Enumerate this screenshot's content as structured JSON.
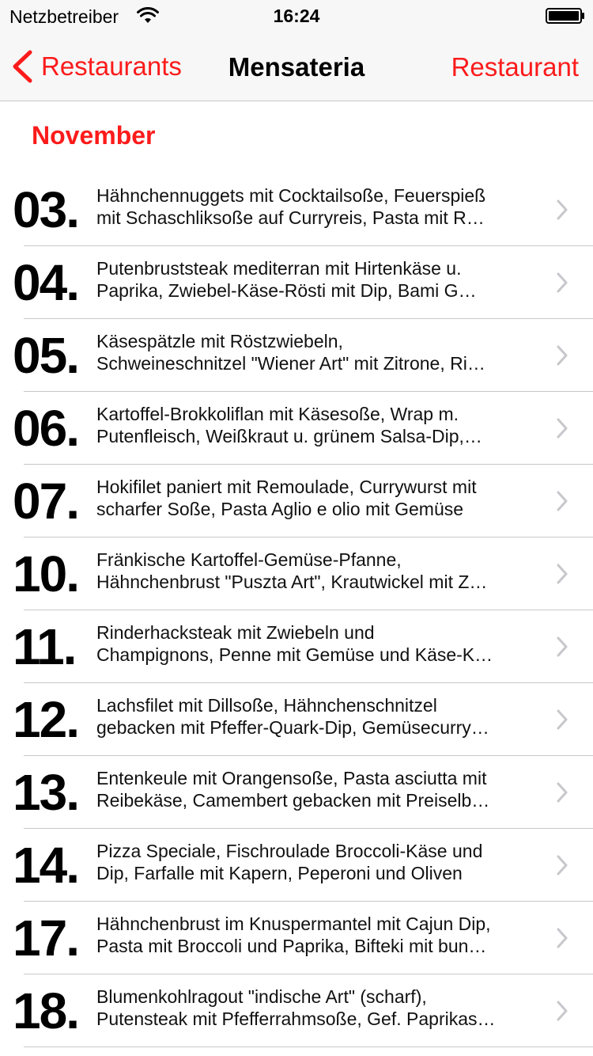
{
  "status_bar": {
    "carrier": "Netzbetreiber",
    "time": "16:24",
    "wifi_icon": "wifi-icon",
    "battery_icon": "battery-full-icon"
  },
  "nav": {
    "back_label": "Restaurants",
    "back_icon": "chevron-left-icon",
    "title": "Mensateria",
    "right_label": "Restaurant"
  },
  "colors": {
    "accent": "#fc1b1b",
    "bar_background": "#f7f7f7",
    "separator": "#c8c7cc",
    "chevron": "#c7c7cc"
  },
  "section": {
    "title": "November"
  },
  "days": [
    {
      "day": "03.",
      "line1": "Hähnchennuggets mit Cocktailsoße, Feuerspieß",
      "line2": "mit Schaschliksoße  auf Curryreis, Pasta mit R…"
    },
    {
      "day": "04.",
      "line1": "Putenbruststeak mediterran mit Hirtenkäse u.",
      "line2": "Paprika, Zwiebel-Käse-Rösti  mit Dip, Bami G…"
    },
    {
      "day": "05.",
      "line1": "Käsespätzle mit Röstzwiebeln,",
      "line2": "Schweineschnitzel \"Wiener Art\" mit Zitrone, Ri…"
    },
    {
      "day": "06.",
      "line1": "Kartoffel-Brokkoliflan mit Käsesoße, Wrap m.",
      "line2": "Putenfleisch, Weißkraut  u. grünem Salsa-Dip,…"
    },
    {
      "day": "07.",
      "line1": "Hokifilet paniert mit Remoulade, Currywurst  mit",
      "line2": "scharfer Soße, Pasta Aglio e olio mit Gemüse"
    },
    {
      "day": "10.",
      "line1": "Fränkische Kartoffel-Gemüse-Pfanne,",
      "line2": "Hähnchenbrust \"Puszta Art\", Krautwickel mit Z…"
    },
    {
      "day": "11.",
      "line1": "Rinderhacksteak mit Zwiebeln und",
      "line2": "Champignons, Penne mit Gemüse und Käse-K…"
    },
    {
      "day": "12.",
      "line1": "Lachsfilet mit Dillsoße, Hähnchenschnitzel",
      "line2": "gebacken mit Pfeffer-Quark-Dip, Gemüsecurry…"
    },
    {
      "day": "13.",
      "line1": "Entenkeule mit Orangensoße, Pasta asciutta mit",
      "line2": "Reibekäse, Camembert gebacken mit Preiselb…"
    },
    {
      "day": "14.",
      "line1": "Pizza Speciale, Fischroulade Broccoli-Käse und",
      "line2": "Dip, Farfalle mit Kapern, Peperoni und Oliven"
    },
    {
      "day": "17.",
      "line1": "Hähnchenbrust im Knuspermantel mit Cajun Dip,",
      "line2": "Pasta mit Broccoli und Paprika, Bifteki mit bun…"
    },
    {
      "day": "18.",
      "line1": "Blumenkohlragout \"indische Art\" (scharf),",
      "line2": "Putensteak mit Pfefferrahmsoße, Gef. Paprikas…"
    }
  ]
}
